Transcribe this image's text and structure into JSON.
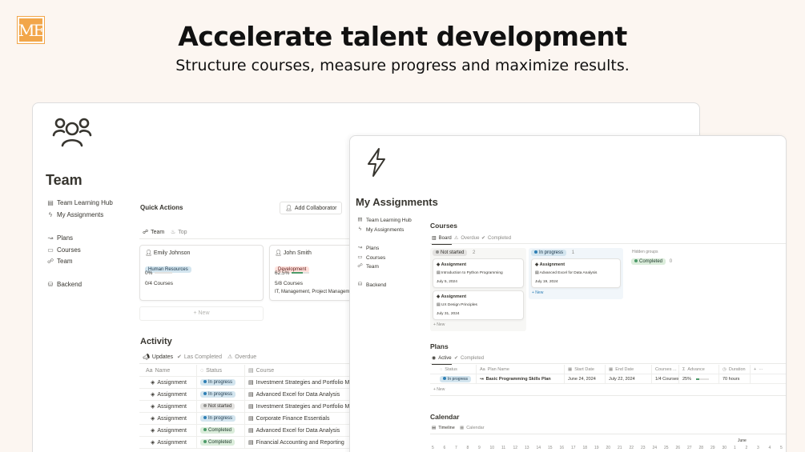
{
  "brand": {
    "logo_text": "ME",
    "accent": "#f2a64a"
  },
  "hero": {
    "title": "Accelerate talent development",
    "subtitle": "Structure courses, measure progress and maximize results."
  },
  "team_page": {
    "icon": "group-icon",
    "title": "Team",
    "nav": [
      {
        "label": "Team Learning Hub",
        "icon": "hub-icon"
      },
      {
        "label": "My Assignments",
        "icon": "bolt-icon"
      },
      {
        "label": "Plans",
        "icon": "route-icon"
      },
      {
        "label": "Courses",
        "icon": "book-icon"
      },
      {
        "label": "Team",
        "icon": "group-icon"
      },
      {
        "label": "Backend",
        "icon": "database-icon"
      }
    ],
    "quick_actions": {
      "title": "Quick Actions",
      "add_collaborator": "Add Collaborator",
      "tabs": [
        "Team",
        "Top"
      ]
    },
    "members": [
      {
        "name": "Emily Johnson",
        "department": "Human Resources",
        "progress": "0%",
        "progress_value": 0,
        "courses": "0/4 Courses",
        "tags": ""
      },
      {
        "name": "John Smith",
        "department": "Development",
        "progress": "62.5%",
        "progress_value": 0.625,
        "courses": "5/8 Courses",
        "tags": "IT, Management, Project Management"
      }
    ],
    "new_label": "+ New",
    "activity": {
      "title": "Activity",
      "tabs": [
        "Updates",
        "Las Completed",
        "Overdue"
      ],
      "columns": [
        "Name",
        "Status",
        "Course"
      ],
      "rows": [
        {
          "name": "Assignment",
          "status": "In progress",
          "course": "Investment Strategies and Portfolio M"
        },
        {
          "name": "Assignment",
          "status": "In progress",
          "course": "Advanced Excel for Data Analysis"
        },
        {
          "name": "Assignment",
          "status": "Not started",
          "course": "Investment Strategies and Portfolio M"
        },
        {
          "name": "Assignment",
          "status": "In progress",
          "course": "Corporate Finance Essentials"
        },
        {
          "name": "Assignment",
          "status": "Completed",
          "course": "Advanced Excel for Data Analysis"
        },
        {
          "name": "Assignment",
          "status": "Completed",
          "course": "Financial Accounting and Reporting"
        }
      ]
    }
  },
  "assignments_page": {
    "icon": "bolt-icon",
    "title": "My Assignments",
    "nav": [
      {
        "label": "Team Learning Hub",
        "icon": "hub-icon"
      },
      {
        "label": "My Assignments",
        "icon": "bolt-icon"
      },
      {
        "label": "Plans",
        "icon": "route-icon"
      },
      {
        "label": "Courses",
        "icon": "book-icon"
      },
      {
        "label": "Team",
        "icon": "group-icon"
      },
      {
        "label": "Backend",
        "icon": "database-icon"
      }
    ],
    "courses": {
      "title": "Courses",
      "tabs": [
        "Board",
        "Overdue",
        "Completed"
      ],
      "columns": [
        {
          "status": "Not started",
          "count": "2",
          "cards": [
            {
              "title": "Assignment",
              "course": "Introduction to Python Programming",
              "date": "July 5, 2024"
            },
            {
              "title": "Assignment",
              "course": "UX Design Principles",
              "date": "July 31, 2024"
            }
          ]
        },
        {
          "status": "In progress",
          "count": "1",
          "cards": [
            {
              "title": "Assignment",
              "course": "Advanced Excel for Data Analysis",
              "date": "July 19, 2024"
            }
          ]
        }
      ],
      "new_label": "+ New",
      "hidden_groups_label": "Hidden groups",
      "hidden_group": {
        "status": "Completed",
        "count": "0"
      }
    },
    "plans": {
      "title": "Plans",
      "tabs": [
        "Active",
        "Completed"
      ],
      "columns": [
        "Status",
        "Plan Name",
        "Start Date",
        "End Date",
        "Courses ...",
        "Advance",
        "Duration"
      ],
      "rows": [
        {
          "status": "In progress",
          "plan_name": "Basic Programming Skills Plan",
          "start": "June 24, 2024",
          "end": "July 22, 2024",
          "courses": "1/4 Courses",
          "advance": "25%",
          "advance_value": 0.25,
          "duration": "70 hours"
        }
      ],
      "new_label": "+ New"
    },
    "calendar": {
      "title": "Calendar",
      "tabs": [
        "Timeline",
        "Calendar"
      ],
      "month": "June",
      "days": [
        "5",
        "6",
        "7",
        "8",
        "9",
        "10",
        "11",
        "12",
        "13",
        "14",
        "15",
        "16",
        "17",
        "18",
        "19",
        "20",
        "21",
        "22",
        "23",
        "24",
        "25",
        "26",
        "27",
        "28",
        "29",
        "30",
        "1",
        "2",
        "3",
        "4",
        "5"
      ]
    }
  }
}
